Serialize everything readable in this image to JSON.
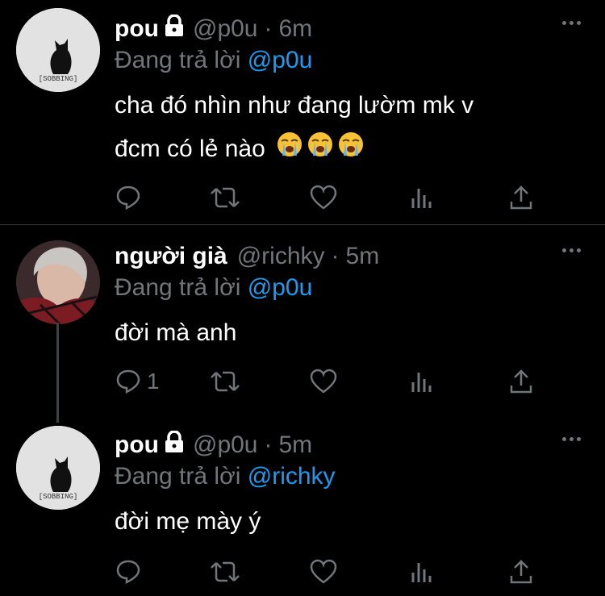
{
  "tweets": [
    {
      "display_name": "pou",
      "handle": "@p0u",
      "separator": "·",
      "time": "6m",
      "reply_prefix": "Đang trả lời",
      "reply_to": "@p0u",
      "text_lines": [
        "cha đó nhìn như đang lườm mk v",
        "đcm có lẻ nào"
      ],
      "emoji": [
        "loudly-crying-face",
        "loudly-crying-face",
        "loudly-crying-face"
      ],
      "avatar_caption": "[SOBBING]",
      "verified_lock": true,
      "reply_count": ""
    },
    {
      "display_name": "người già",
      "handle": "@richky",
      "separator": "·",
      "time": "5m",
      "reply_prefix": "Đang trả lời",
      "reply_to": "@p0u",
      "text_lines": [
        "đời mà anh"
      ],
      "verified_lock": false,
      "reply_count": "1"
    },
    {
      "display_name": "pou",
      "handle": "@p0u",
      "separator": "·",
      "time": "5m",
      "reply_prefix": "Đang trả lời",
      "reply_to": "@richky",
      "text_lines": [
        "đời mẹ mày ý"
      ],
      "avatar_caption": "[SOBBING]",
      "verified_lock": true,
      "reply_count": ""
    }
  ],
  "icons": [
    "reply-icon",
    "retweet-icon",
    "like-icon",
    "analytics-icon",
    "share-icon",
    "more-icon",
    "lock-icon"
  ],
  "colors": {
    "background": "#000000",
    "muted": "#71767b",
    "link": "#1d9bf0",
    "text": "#ffffff"
  }
}
